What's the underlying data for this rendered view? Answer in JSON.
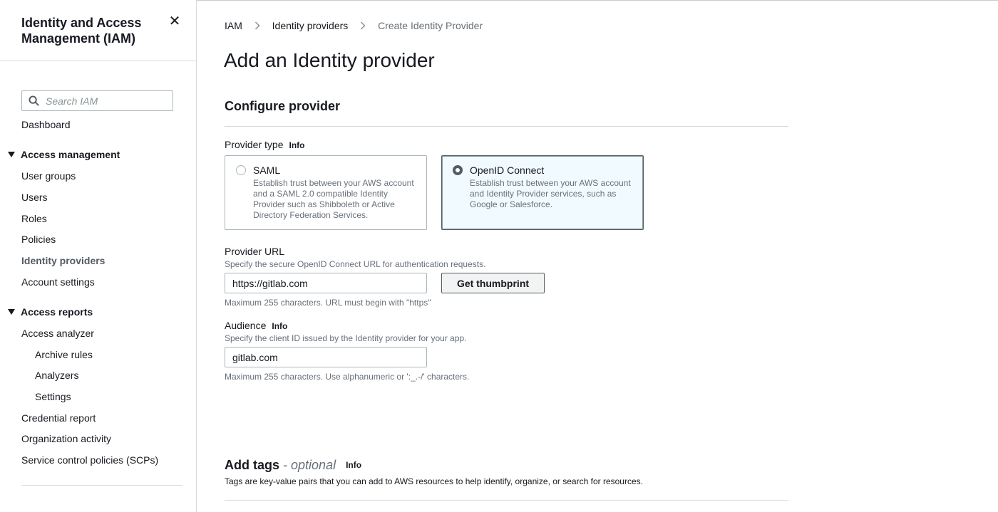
{
  "sidebar": {
    "title": "Identity and Access Management (IAM)",
    "search_placeholder": "Search IAM",
    "dashboard": "Dashboard",
    "access_management": {
      "label": "Access management",
      "items": [
        "User groups",
        "Users",
        "Roles",
        "Policies",
        "Identity providers",
        "Account settings"
      ],
      "active": "Identity providers"
    },
    "access_reports": {
      "label": "Access reports",
      "analyzer": "Access analyzer",
      "analyzer_subitems": [
        "Archive rules",
        "Analyzers",
        "Settings"
      ],
      "items": [
        "Credential report",
        "Organization activity",
        "Service control policies (SCPs)"
      ]
    }
  },
  "breadcrumb": [
    "IAM",
    "Identity providers",
    "Create Identity Provider"
  ],
  "page_title": "Add an Identity provider",
  "configure": {
    "title": "Configure provider",
    "provider_type_label": "Provider type",
    "info_label": "Info",
    "options": [
      {
        "title": "SAML",
        "description": "Establish trust between your AWS account and a SAML 2.0 compatible Identity Provider such as Shibboleth or Active Directory Federation Services.",
        "selected": false
      },
      {
        "title": "OpenID Connect",
        "description": "Establish trust between your AWS account and Identity Provider services, such as Google or Salesforce.",
        "selected": true
      }
    ],
    "provider_url": {
      "label": "Provider URL",
      "description": "Specify the secure OpenID Connect URL for authentication requests.",
      "value": "https://gitlab.com",
      "constraint": "Maximum 255 characters. URL must begin with \"https\""
    },
    "thumbprint_button": "Get thumbprint",
    "audience": {
      "label": "Audience",
      "description": "Specify the client ID issued by the Identity provider for your app.",
      "value": "gitlab.com",
      "constraint": "Maximum 255 characters. Use alphanumeric or ':_.-/' characters."
    }
  },
  "tags": {
    "title": "Add tags",
    "optional": "- optional",
    "description": "Tags are key-value pairs that you can add to AWS resources to help identify, organize, or search for resources."
  },
  "colors": {
    "text": "#16191f",
    "secondary_text": "#687078",
    "border": "#aab7b8",
    "selected_tile_bg": "#f1faff"
  }
}
